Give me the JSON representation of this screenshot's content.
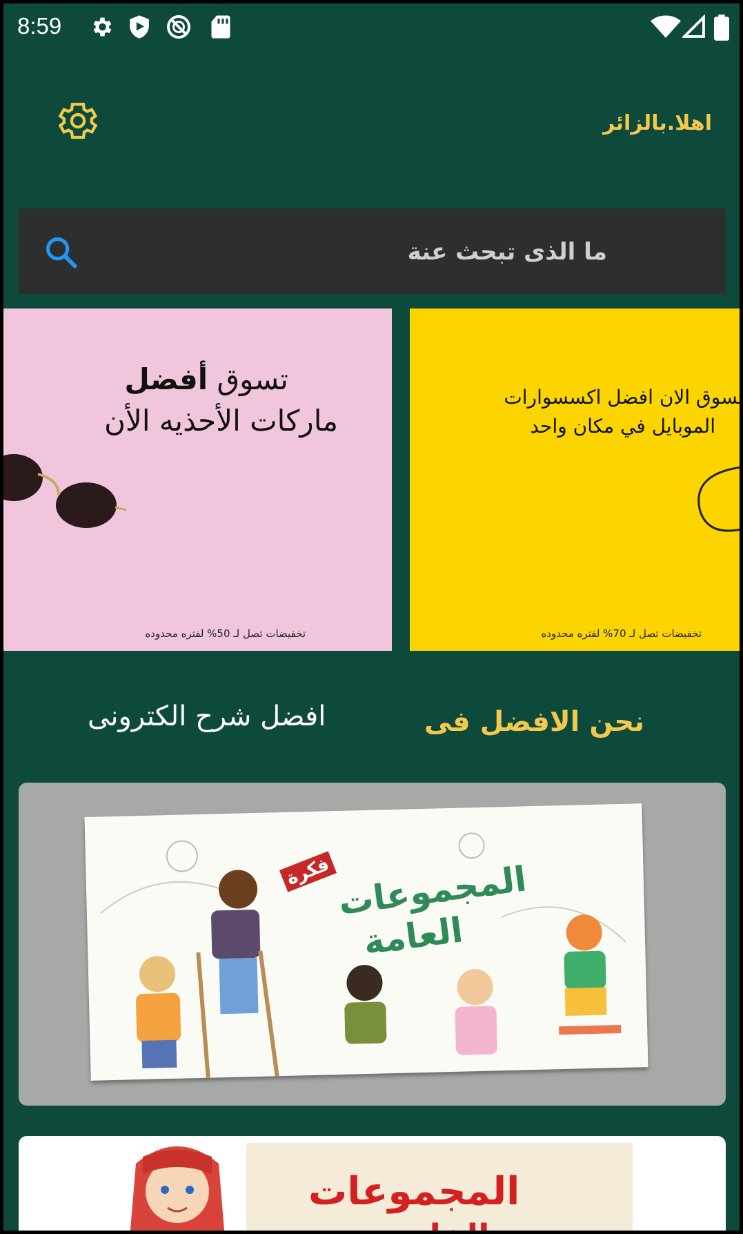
{
  "status_bar": {
    "time": "8:59",
    "left_icons": [
      "gear-icon",
      "shield-play-icon",
      "do-not-disturb-icon",
      "sd-card-icon"
    ],
    "right_icons": [
      "wifi-icon",
      "signal-icon",
      "battery-icon"
    ]
  },
  "header": {
    "greeting": "اهلا.بالزائر",
    "settings_icon": "gear-icon",
    "accent_color": "#f2c94c"
  },
  "search": {
    "placeholder": "ما الذى تبحث عنة",
    "icon": "search-icon",
    "icon_color": "#2196f3"
  },
  "banners": [
    {
      "line1_prefix": "تسوق ",
      "line1_bold": "أفضل",
      "line2": "ماركات الأحذيه الأن",
      "promo": "تخفيضات تصل لـ 50% لفتره محدوده",
      "background": "#f1c6dc"
    },
    {
      "line1": "تسوق الان افضل اكسسوارات",
      "line2": "الموبايل في مكان واحد",
      "promo": "تخفيضات تصل لـ 70% لفتره محدوده",
      "background": "#fcd500"
    }
  ],
  "tagline": {
    "gold": "نحن الافضل فى",
    "white": "افضل شرح الكترونى"
  },
  "cards": [
    {
      "title_line1": "المجموعات",
      "title_line2": "العامة",
      "badge": "فكرة"
    },
    {
      "title_line1": "المجموعات",
      "title_line2": "الخاصة"
    }
  ],
  "colors": {
    "background": "#0d4a3c",
    "search_bg": "#2d2f2e"
  }
}
